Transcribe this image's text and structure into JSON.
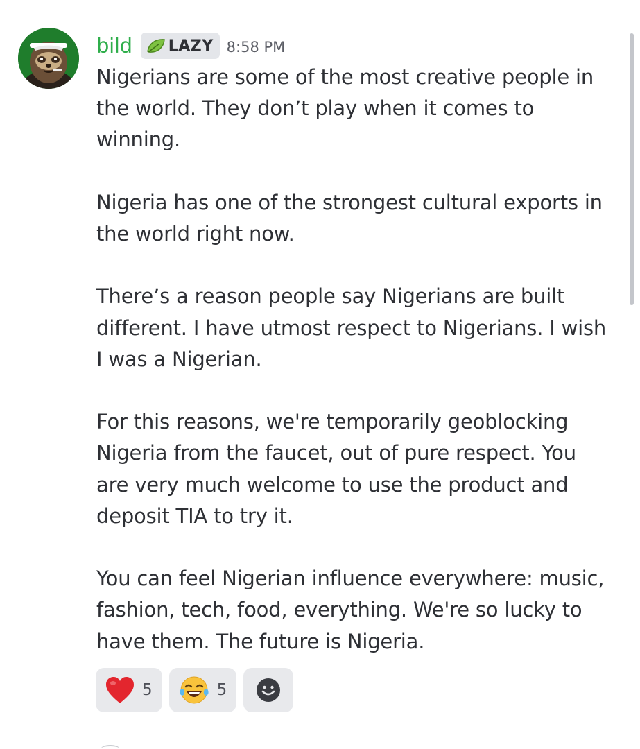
{
  "message": {
    "author": "bild",
    "role_tag": "LAZY",
    "timestamp": "8:58 PM",
    "paragraphs": [
      "Nigerians are some of the most creative people in the world. They don’t play when it comes to winning.",
      "Nigeria has one of the strongest cultural exports in the world right now.",
      "There’s a reason people say Nigerians are built different. I have utmost respect to Nigerians. I wish I was a Nigerian.",
      "For this reasons, we're temporarily geoblocking Nigeria from the faucet, out of pure respect. You are very much welcome to use the product and deposit TIA to try it.",
      "You can feel Nigerian influence everywhere: music, fashion, tech, food, everything. We're so lucky to have them. The future is Nigeria."
    ]
  },
  "reactions": [
    {
      "icon": "red-heart-icon",
      "count": "5"
    },
    {
      "icon": "tears-of-joy-emoji-icon",
      "count": "5"
    }
  ],
  "add_reaction": {
    "icon": "add-reaction-smiley-icon"
  },
  "colors": {
    "username": "#2fae4b",
    "text": "#2e3035",
    "timestamp": "#5c5e66",
    "reaction_bg": "#e8e9ec",
    "tag_bg": "#e4e6ea"
  }
}
